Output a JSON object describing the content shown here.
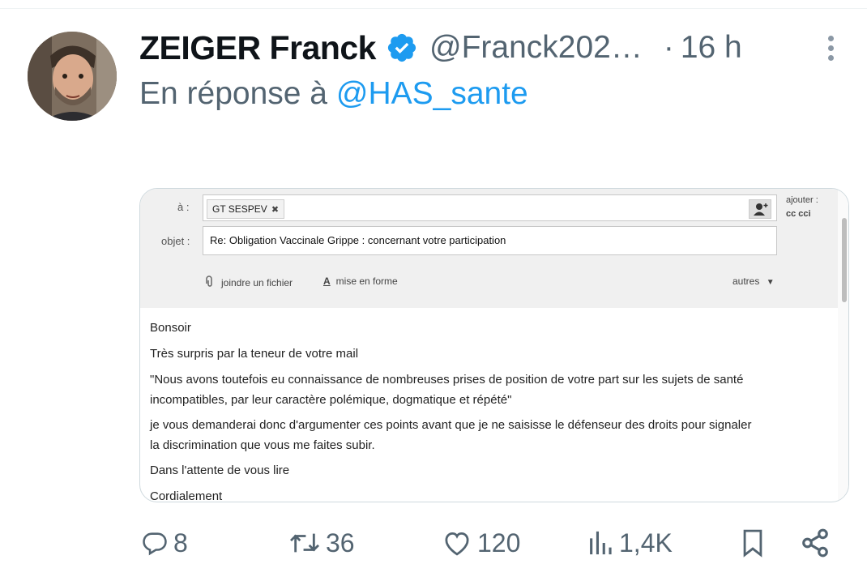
{
  "tweet": {
    "author_name": "ZEIGER Franck",
    "author_handle": "@Franck202…",
    "time_separator": "·",
    "time": "16 h",
    "reply_prefix": "En réponse à",
    "reply_to": "@HAS_sante",
    "verified_icon": "verified-badge-icon"
  },
  "email": {
    "to_label": "à :",
    "recipient_chip": "GT SESPEV",
    "chip_remove": "✖",
    "add_label": "ajouter :",
    "add_options": "cc   cci",
    "subject_label": "objet :",
    "subject": "Re: Obligation Vaccinale Grippe : concernant votre participation",
    "attach_label": "joindre un fichier",
    "format_label": "mise en forme",
    "others_label": "autres",
    "body": [
      "Bonsoir",
      "Très surpris par la teneur de votre mail",
      "\"Nous avons toutefois eu connaissance de nombreuses prises de position de votre part sur les sujets de santé",
      "incompatibles, par leur caractère polémique, dogmatique et répété\"",
      "je vous demanderai donc d'argumenter ces points avant que je ne saisisse le défenseur des droits pour signaler",
      "la discrimination que vous me faites subir.",
      "Dans l'attente de vous lire",
      "Cordialement"
    ]
  },
  "actions": {
    "replies": "8",
    "retweets": "36",
    "likes": "120",
    "views": "1,4K"
  },
  "colors": {
    "accent": "#1d9bf0",
    "muted": "#536471",
    "text": "#0f1419"
  }
}
